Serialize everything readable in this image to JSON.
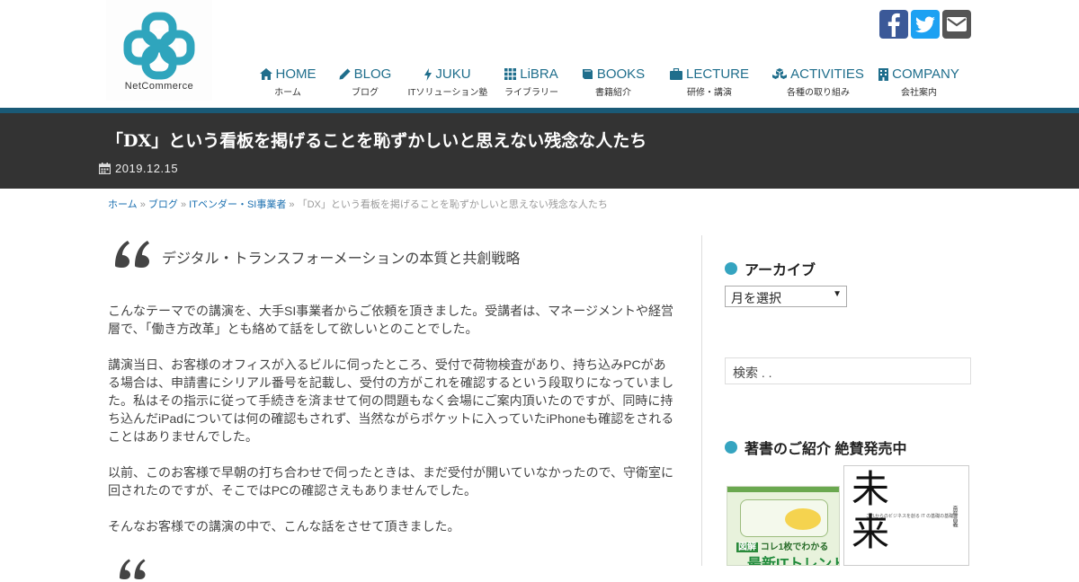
{
  "brand": {
    "name": "NetCommerce",
    "color": "#2fa5bd"
  },
  "nav": [
    {
      "label": "HOME",
      "sub": "ホーム",
      "icon": "home-icon"
    },
    {
      "label": "BLOG",
      "sub": "ブログ",
      "icon": "pencil-icon"
    },
    {
      "label": "JUKU",
      "sub": "ITソリューション塾",
      "icon": "bolt-icon"
    },
    {
      "label": "LiBRA",
      "sub": "ライブラリー",
      "icon": "grid-icon"
    },
    {
      "label": "BOOKS",
      "sub": "書籍紹介",
      "icon": "book-icon"
    },
    {
      "label": "LECTURE",
      "sub": "研修・講演",
      "icon": "briefcase-icon"
    },
    {
      "label": "ACTIVITIES",
      "sub": "各種の取り組み",
      "icon": "cubes-icon"
    },
    {
      "label": "COMPANY",
      "sub": "会社案内",
      "icon": "building-icon"
    }
  ],
  "social": [
    "facebook-icon",
    "twitter-icon",
    "mail-icon"
  ],
  "post": {
    "title": "「DX」という看板を掲げることを恥ずかしいと思えない残念な人たち",
    "date": "2019.12.15"
  },
  "breadcrumb": {
    "home": "ホーム",
    "blog": "ブログ",
    "category": "ITベンダー・SI事業者",
    "current": "「DX」という看板を掲げることを恥ずかしいと思えない残念な人たち",
    "sep": "»"
  },
  "content": {
    "subheading": "デジタル・トランスフォーメーションの本質と共創戦略",
    "p1": "こんなテーマでの講演を、大手SI事業者からご依頼を頂きました。受講者は、マネージメントや経営層で、「働き方改革」とも絡めて話をして欲しいとのことでした。",
    "p2": "講演当日、お客様のオフィスが入るビルに伺ったところ、受付で荷物検査があり、持ち込みPCがある場合は、申請書にシリアル番号を記載し、受付の方がこれを確認するという段取りになっていました。私はその指示に従って手続きを済ませて何の問題もなく会場にご案内頂いたのですが、同時に持ち込んだiPadについては何の確認もされず、当然ながらポケットに入っていたiPhoneも確認をされることはありませんでした。",
    "p3": "以前、このお客様で早朝の打ち合わせで伺ったときは、まだ受付が開いていなかったので、守衛室に回されたのですが、そこではPCの確認さえもありませんでした。",
    "p4": "そんなお客様での講演の中で、こんな話をさせて頂きました。"
  },
  "sidebar": {
    "archive_title": "アーカイブ",
    "archive_select": "月を選択",
    "search_placeholder": "検索 . .",
    "books_title": "著書のご紹介 絶賛発売中",
    "book1_text": "コレ1枚でわかる",
    "book1_big": "最新ITトレンド",
    "book1_tag": "図解",
    "book2_big": "未来",
    "book2_sub": "これからのビジネスを創る IT の基礎の基礎",
    "book2_author": "斎藤昌義"
  },
  "colors": {
    "accent": "#2fa5bd",
    "nav_text": "#1f6e8c",
    "band": "#333333",
    "stripe": "#1a5a77"
  }
}
